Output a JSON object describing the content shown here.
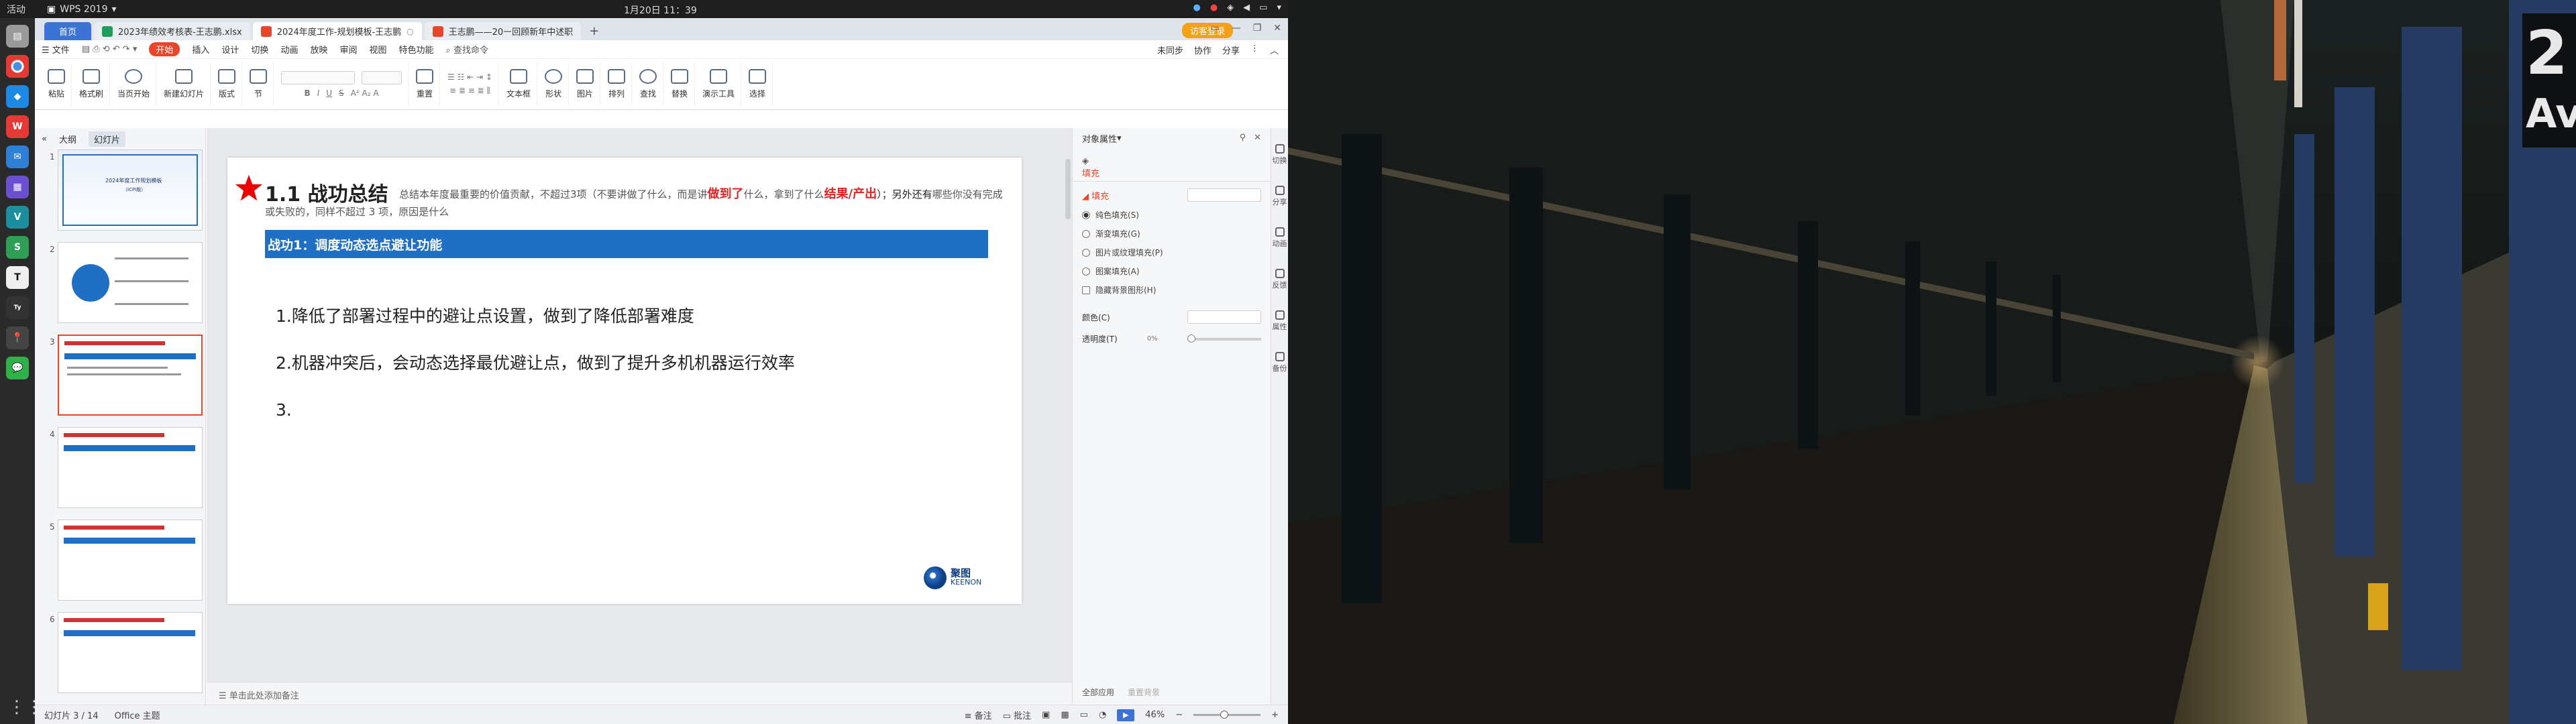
{
  "system": {
    "activities": "活动",
    "app_name": "WPS 2019",
    "clock": "1月20日  11：39"
  },
  "dock": [
    "Files",
    "Chrome",
    "VS Code",
    "WPS",
    "Mail",
    "Apps",
    "VS",
    "Search",
    "Terminal",
    "Typora",
    "Pin",
    "WeChat"
  ],
  "tabs": {
    "home": "首页",
    "items": [
      {
        "label": "2023年绩效考核表-王志鹏.xlsx",
        "color": "#1f9e5a"
      },
      {
        "label": "2024年度工作-规划模板-王志鹏",
        "color": "#e8452a",
        "active": true
      },
      {
        "label": "王志鹏——20㇐回顾新年中述职",
        "color": "#e8452a"
      }
    ],
    "login": "访客登录"
  },
  "menu": {
    "file": "文件",
    "items": [
      "开始",
      "插入",
      "设计",
      "切换",
      "动画",
      "放映",
      "审阅",
      "视图",
      "特色功能"
    ],
    "search": "查找命令",
    "right": [
      "未同步",
      "协作",
      "分享"
    ]
  },
  "ribbon": {
    "groups": [
      "粘贴",
      "格式刷",
      "当页开始",
      "新建幻灯片",
      "版式",
      "节",
      "重置",
      "文本框",
      "形状",
      "图片",
      "排列",
      "查找",
      "替换",
      "演示工具",
      "选择"
    ]
  },
  "left": {
    "tab_outline": "大纲",
    "tab_slides": "幻灯片",
    "slide_numbers": [
      "1",
      "2",
      "3",
      "4",
      "5",
      "6"
    ],
    "cover_title": "2024年度工作规划模板",
    "cover_sub": "（ICPI版）"
  },
  "slide": {
    "title": "1.1 战功总结",
    "desc_a": "总结本年度最重要的价值贡献，不超过3项（不要讲做了什么，而是讲",
    "desc_red1": "做到了",
    "desc_b": "什么，拿到了什么",
    "desc_red2": "结果/产出",
    "desc_c": "）；另外还有",
    "desc_d": "哪些你没有完成或失败的，同样不超过 3 项，原因是什么",
    "bar": "战功1：调度动态选点避让功能",
    "items": [
      "1.降低了部署过程中的避让点设置，做到了降低部署难度",
      "2.机器冲突后，会动态选择最优避让点，做到了提升多机机器运行效率",
      "3."
    ],
    "logo_cn": "聚图",
    "logo_en": "KEENON"
  },
  "notes": "单击此处添加备注",
  "props": {
    "title": "对象属性",
    "tab": "填充",
    "fill_label": "填充",
    "options": [
      "纯色填充(S)",
      "渐变填充(G)",
      "图片或纹理填充(P)",
      "图案填充(A)",
      "隐藏背景图形(H)"
    ],
    "color_label": "颜色(C)",
    "transparency_label": "透明度(T)",
    "transparency_value": "0%",
    "bottom": [
      "全部应用",
      "重置背景"
    ]
  },
  "rightbar": [
    "切换",
    "分享",
    "动画",
    "反馈",
    "属性",
    "备份"
  ],
  "status": {
    "slide": "幻灯片 3 / 14",
    "theme": "Office 主题",
    "notes_btn": "备注",
    "comment_btn": "批注",
    "zoom": "46%"
  },
  "colors": {
    "accent": "#e8452a",
    "slide_bar": "#1f6fc5",
    "home_tab": "#3d73d6"
  }
}
